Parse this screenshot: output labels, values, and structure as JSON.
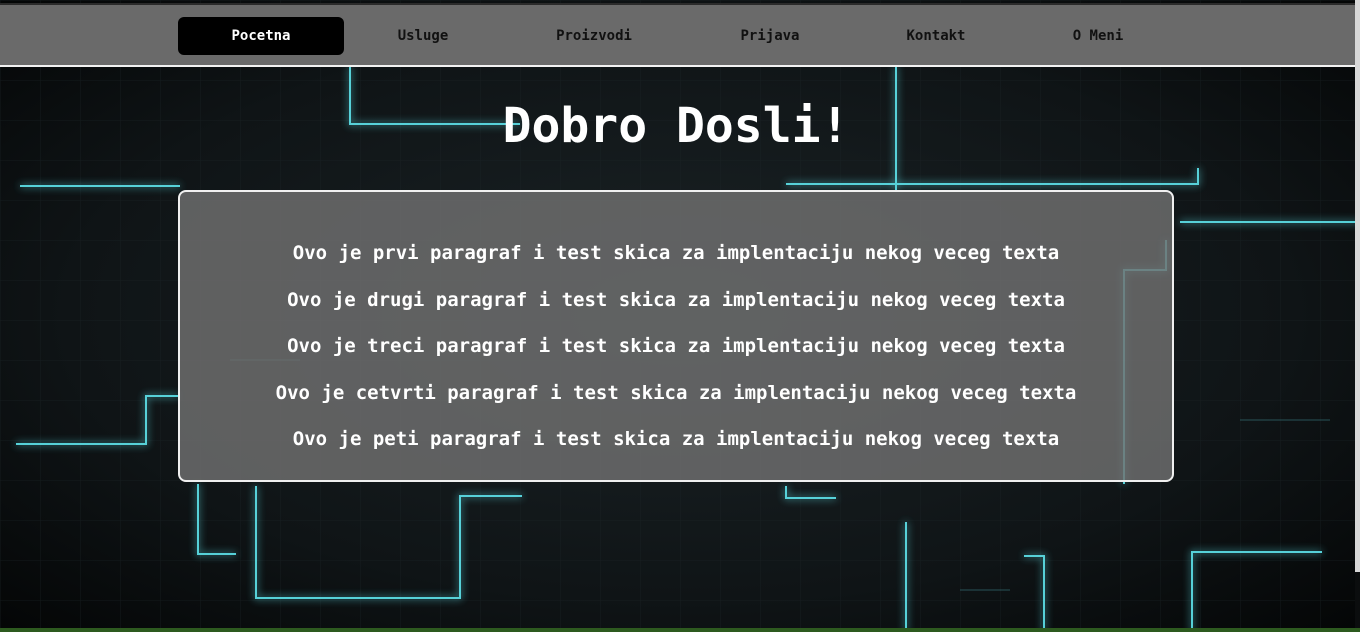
{
  "nav": {
    "items": [
      {
        "label": "Pocetna",
        "active": true
      },
      {
        "label": "Usluge",
        "active": false
      },
      {
        "label": "Proizvodi",
        "active": false
      },
      {
        "label": "Prijava",
        "active": false
      },
      {
        "label": "Kontakt",
        "active": false
      },
      {
        "label": "O Meni",
        "active": false
      }
    ]
  },
  "hero": {
    "title": "Dobro Dosli!"
  },
  "content": {
    "paragraphs": [
      "Ovo je prvi paragraf i test skica za implentaciju nekog veceg texta",
      "Ovo je drugi paragraf i test skica za implentaciju nekog veceg texta",
      "Ovo je treci paragraf i test skica za implentaciju nekog veceg texta",
      "Ovo je cetvrti paragraf i test skica za implentaciju nekog veceg texta",
      "Ovo je peti paragraf i test skica za implentaciju nekog veceg texta"
    ]
  },
  "colors": {
    "navbar_bg": "#6a6a6a",
    "active_tab_bg": "#000000",
    "glow_accent": "#5fe6ee",
    "content_box_bg": "#707070",
    "page_bg": "#0b0d0e"
  }
}
